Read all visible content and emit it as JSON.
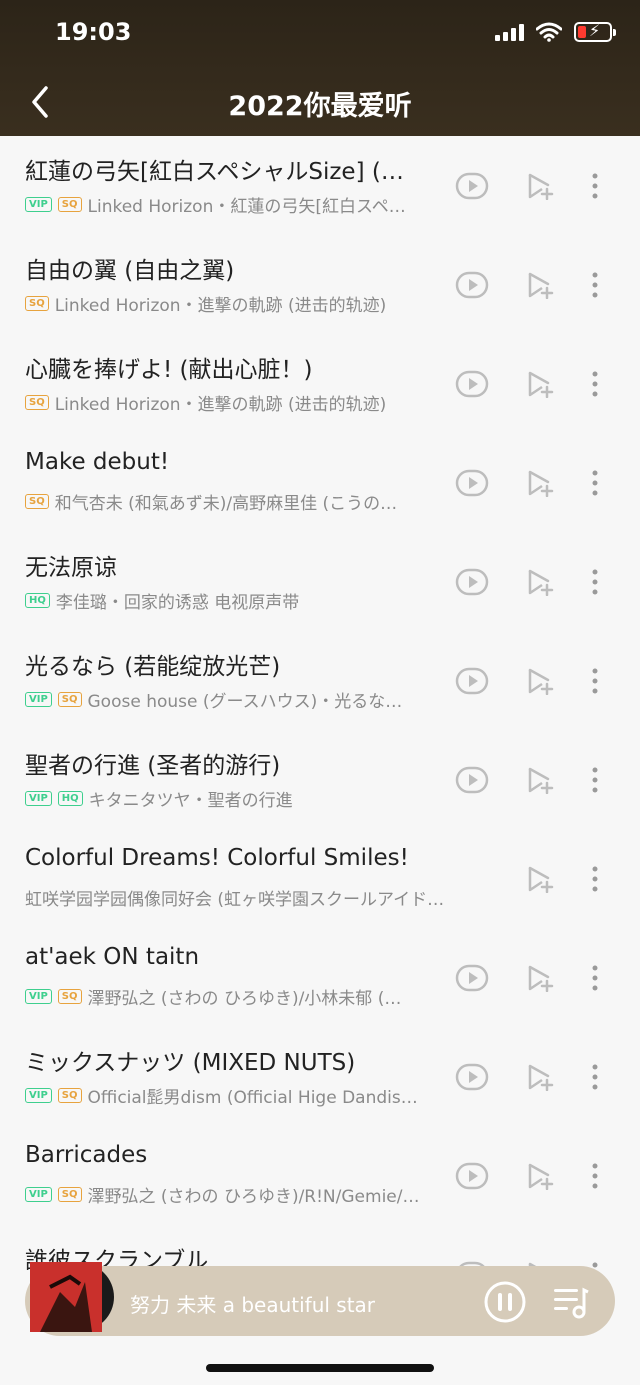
{
  "status_bar": {
    "time": "19:03"
  },
  "header": {
    "title": "2022你最爱听"
  },
  "songs": [
    {
      "title": "紅蓮の弓矢[紅白スペシャルSize] (…",
      "badges": [
        "VIP",
        "SQ"
      ],
      "subtitle": "Linked Horizon・紅蓮の弓矢[紅白スペ…",
      "video": true
    },
    {
      "title": "自由の翼 (自由之翼)",
      "badges": [
        "SQ"
      ],
      "subtitle": "Linked Horizon・進撃の軌跡 (进击的轨迹)",
      "video": true
    },
    {
      "title": "心臓を捧げよ! (献出心脏！)",
      "badges": [
        "SQ"
      ],
      "subtitle": "Linked Horizon・進撃の軌跡 (进击的轨迹)",
      "video": true
    },
    {
      "title": "Make debut!",
      "badges": [
        "SQ"
      ],
      "subtitle": "和气杏未 (和氣あず未)/高野麻里佳 (こうの…",
      "video": true
    },
    {
      "title": "无法原谅",
      "badges": [
        "HQ"
      ],
      "subtitle": "李佳璐・回家的诱惑 电视原声带",
      "video": true
    },
    {
      "title": "光るなら (若能绽放光芒)",
      "badges": [
        "VIP",
        "SQ"
      ],
      "subtitle": "Goose house (グースハウス)・光るな…",
      "video": true
    },
    {
      "title": "聖者の行進 (圣者的游行)",
      "badges": [
        "VIP",
        "HQ"
      ],
      "subtitle": "キタニタツヤ・聖者の行進",
      "video": true
    },
    {
      "title": "Colorful Dreams! Colorful Smiles!",
      "badges": [],
      "subtitle": "虹咲学园学园偶像同好会 (虹ヶ咲学園スクールアイド…",
      "video": false
    },
    {
      "title": "at'aek ON taitn",
      "badges": [
        "VIP",
        "SQ"
      ],
      "subtitle": "澤野弘之 (さわの ひろゆき)/小林未郁 (…",
      "video": true
    },
    {
      "title": "ミックスナッツ (MIXED NUTS)",
      "badges": [
        "VIP",
        "SQ"
      ],
      "subtitle": "Official髭男dism (Official Hige Dandis…",
      "video": true
    },
    {
      "title": "Barricades",
      "badges": [
        "VIP",
        "SQ"
      ],
      "subtitle": "澤野弘之 (さわの ひろゆき)/R!N/Gemie/…",
      "video": true
    },
    {
      "title": "誰彼スクランブル",
      "badges": [],
      "subtitle": "",
      "video": true
    }
  ],
  "now_playing": {
    "title": "努力 未来 a beautiful star"
  },
  "colors": {
    "header_bg": "#2c2418",
    "player_bg": "#d6cbb9",
    "vip": "#3ecf8e",
    "sq": "#e7a33e"
  }
}
